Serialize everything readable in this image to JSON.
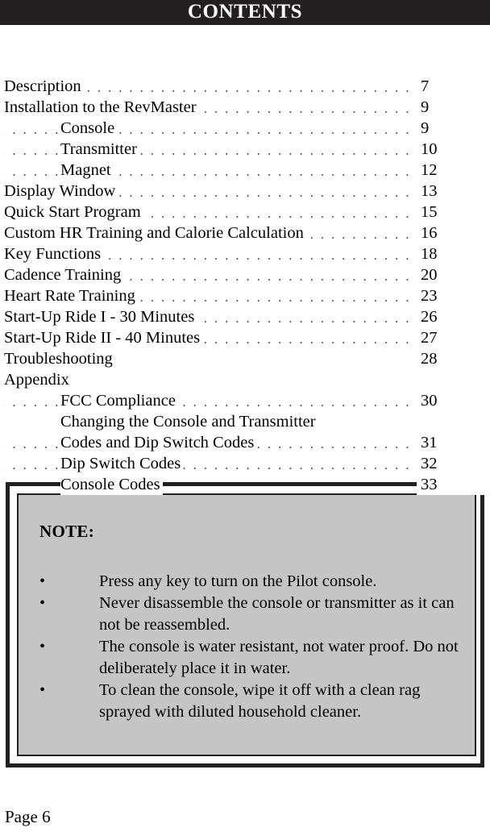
{
  "header": {
    "title": "CONTENTS",
    "bar_color": "#231f20",
    "text_color": "#ffffff"
  },
  "toc": {
    "entries": [
      {
        "label": "Description",
        "page": "7",
        "indent": false,
        "leaders": true
      },
      {
        "label": "Installation to the RevMaster",
        "page": "9",
        "indent": false,
        "leaders": true
      },
      {
        "label": "Console",
        "page": "9",
        "indent": true,
        "leaders": true
      },
      {
        "label": "Transmitter",
        "page": "10",
        "indent": true,
        "leaders": true
      },
      {
        "label": "Magnet",
        "page": "12",
        "indent": true,
        "leaders": true
      },
      {
        "label": "Display Window",
        "page": "13",
        "indent": false,
        "leaders": true
      },
      {
        "label": "Quick Start Program",
        "page": "15",
        "indent": false,
        "leaders": true
      },
      {
        "label": "Custom HR Training and Calorie Calculation",
        "page": "16",
        "indent": false,
        "leaders": true
      },
      {
        "label": "Key Functions",
        "page": "18",
        "indent": false,
        "leaders": true
      },
      {
        "label": "Cadence Training",
        "page": "20",
        "indent": false,
        "leaders": true
      },
      {
        "label": "Heart Rate Training",
        "page": "23",
        "indent": false,
        "leaders": true
      },
      {
        "label": "Start-Up Ride I - 30 Minutes",
        "page": "26",
        "indent": false,
        "leaders": true
      },
      {
        "label": "Start-Up Ride II - 40 Minutes",
        "page": "27",
        "indent": false,
        "leaders": true
      },
      {
        "label": "Troubleshooting",
        "page": "28",
        "indent": false,
        "leaders": false
      },
      {
        "label": "Appendix",
        "page": "",
        "indent": false,
        "leaders": false
      },
      {
        "label": "FCC Compliance",
        "page": "30",
        "indent": true,
        "leaders": true
      },
      {
        "label": "Changing the Console and Transmitter",
        "page": "",
        "indent": true,
        "leaders": false
      },
      {
        "label": "Codes and Dip Switch Codes",
        "page": "31",
        "indent": true,
        "leaders": true
      },
      {
        "label": "Dip Switch Codes",
        "page": "32",
        "indent": true,
        "leaders": true
      },
      {
        "label": "Console Codes",
        "page": "33",
        "indent": true,
        "leaders": true
      }
    ]
  },
  "note": {
    "title": "NOTE:",
    "panel_color": "#c5c5c5",
    "border_color": "#231f20",
    "bullet_glyph": "•",
    "items": [
      "Press any key to turn on the Pilot console.",
      "Never disassemble the console or transmitter as it can not be reassembled.",
      "The console is water resistant, not water proof. Do not deliberately place it in water.",
      "To clean the console, wipe it off with a clean rag sprayed with diluted household cleaner."
    ]
  },
  "footer": {
    "page_label": "Page 6"
  }
}
